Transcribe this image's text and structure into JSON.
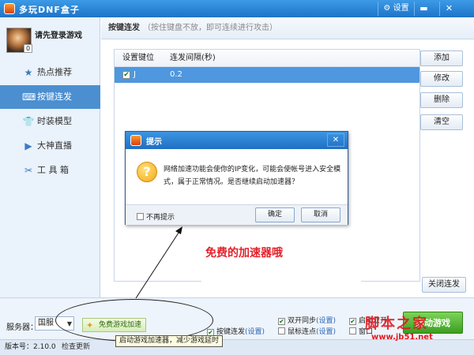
{
  "window": {
    "title": "多玩DNF盒子",
    "settings_label": "设置",
    "minimize_glyph": "▬",
    "close_glyph": "✕"
  },
  "sidebar": {
    "login_text": "请先登录游戏",
    "avatar_badge": "0",
    "items": [
      {
        "label": "热点推荐",
        "icon": "star-icon",
        "glyph": "★",
        "active": false
      },
      {
        "label": "按键连发",
        "icon": "keyboard-icon",
        "glyph": "⌨",
        "active": true
      },
      {
        "label": "时装模型",
        "icon": "shirt-icon",
        "glyph": "👕",
        "active": false
      },
      {
        "label": "大神直播",
        "icon": "play-icon",
        "glyph": "▶",
        "active": false
      },
      {
        "label": "工 具 箱",
        "icon": "tools-icon",
        "glyph": "✂",
        "active": false
      }
    ]
  },
  "main": {
    "title": "按键连发",
    "hint": "（按住键盘不放，即可连续进行攻击）",
    "table": {
      "headers": [
        "设置键位",
        "连发间隔(秒)"
      ],
      "rows": [
        {
          "checked": true,
          "key": "J",
          "interval": "0.2"
        }
      ]
    },
    "buttons": {
      "add": "添加",
      "edit": "修改",
      "delete": "删除",
      "clear": "清空",
      "close_burst": "关闭连发"
    }
  },
  "bottom": {
    "server_label": "服务器：",
    "server_value": "国服",
    "accel_button": "免费游戏加速",
    "options": [
      {
        "label": "按键连发",
        "link": "(设置)",
        "checked": true
      },
      {
        "label": "双开同步",
        "link": "(设置)",
        "checked": true
      },
      {
        "label": "鼠标连点",
        "link": "(设置)",
        "checked": false
      },
      {
        "label": "启动双开",
        "link": "",
        "checked": true
      },
      {
        "label": "窗口",
        "link": "",
        "checked": false
      }
    ],
    "start_button": "启动游戏"
  },
  "status": {
    "version": "版本号：2.10.0",
    "check_update": "检查更新"
  },
  "tooltip": "启动游戏加速器，减少游戏延时",
  "annotation": "免费的加速器哦",
  "dialog": {
    "title": "提示",
    "message": "网络加速功能会使你的IP变化，可能会使帐号进入安全模式，属于正常情况。是否继续启动加速器？",
    "no_more": "不再提示",
    "ok": "确定",
    "cancel": "取消"
  },
  "watermark": {
    "text": "脚本之家",
    "url": "www.jb51.net"
  }
}
